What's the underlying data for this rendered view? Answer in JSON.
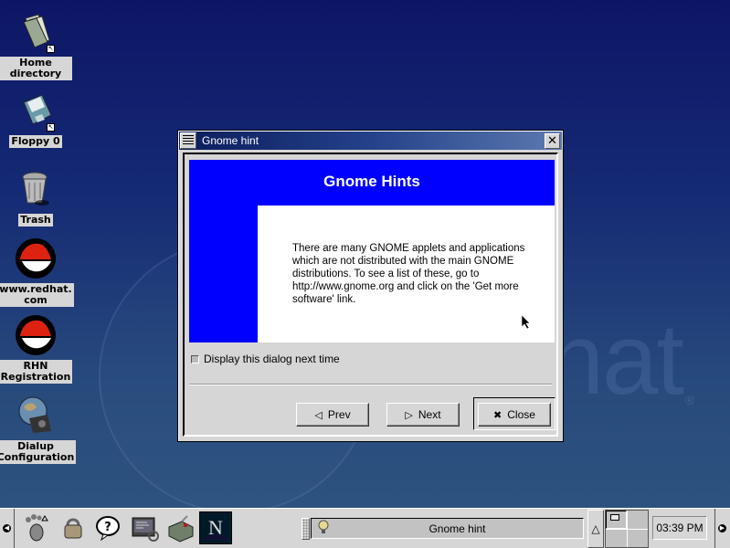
{
  "desktop": {
    "icons": [
      {
        "label": "Home directory",
        "icon": "folder-icon"
      },
      {
        "label": "Floppy 0",
        "icon": "floppy-icon"
      },
      {
        "label": "Trash",
        "icon": "trash-icon"
      },
      {
        "label": "www.redhat.\ncom",
        "icon": "redhat-icon"
      },
      {
        "label": "RHN\nRegistration",
        "icon": "redhat-icon"
      },
      {
        "label": "Dialup\nConfiguration",
        "icon": "dialup-icon"
      }
    ],
    "watermark": "hat",
    "watermark_reg": "®"
  },
  "dialog": {
    "window_title": "Gnome hint",
    "heading": "Gnome Hints",
    "hint_text": "There are many GNOME applets and applications which are not distributed with the main GNOME distributions.  To see a list of these, go to http://www.gnome.org and click on the 'Get more software' link.",
    "checkbox_label": "Display this dialog next time",
    "checkbox_checked": false,
    "buttons": {
      "prev": "Prev",
      "next": "Next",
      "close": "Close"
    },
    "colors": {
      "hint_background": "#0000ff"
    }
  },
  "panel": {
    "task_title": "Gnome hint",
    "clock": "03:39 PM",
    "launchers": [
      "gnome-foot-icon",
      "lock-icon",
      "help-icon",
      "terminal-icon",
      "toolbox-icon",
      "netscape-icon"
    ]
  }
}
